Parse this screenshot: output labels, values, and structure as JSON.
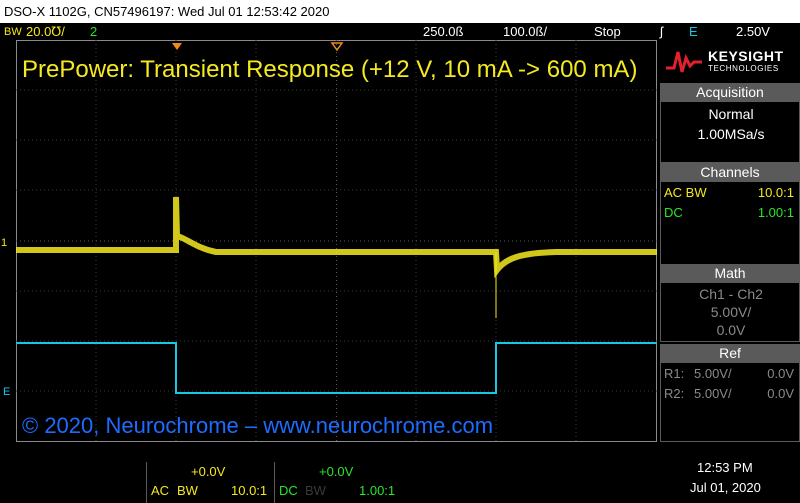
{
  "window": {
    "title": "DSO-X 1102G, CN57496197: Wed Jul 01 12:53:42 2020"
  },
  "top_status": {
    "ch1_bw": "BW",
    "ch1_scale": "20.0℧/",
    "ch2_num": "2",
    "timebase": "250.0ß",
    "delay": "100.0ß/",
    "run_state": "Stop",
    "trigger_icon": "trigger-edge-icon",
    "trigger_source": "E",
    "trigger_level": "2.50V"
  },
  "plot": {
    "title": "PrePower: Transient Response (+12 V, 10 mA -> 600 mA)",
    "copyright": "© 2020, Neurochrome – www.neurochrome.com",
    "ch1_marker": "1",
    "ext_marker": "E",
    "colors": {
      "ch1": "#f4ea1f",
      "ch2": "#19c6e6",
      "ext": "#19c6e6",
      "title": "#f4ea1f",
      "copyright": "#1e6cff"
    }
  },
  "panel": {
    "brand_name": "KEYSIGHT",
    "brand_sub": "TECHNOLOGIES",
    "acquisition": {
      "header": "Acquisition",
      "mode": "Normal",
      "rate": "1.00MSa/s"
    },
    "channels": {
      "header": "Channels",
      "rows": [
        {
          "label": "AC BW",
          "value": "10.0:1",
          "color": "#f4ea1f"
        },
        {
          "label": "DC",
          "value": "1.00:1",
          "color": "#29e629"
        }
      ]
    },
    "math": {
      "header": "Math",
      "expr": "Ch1 - Ch2",
      "scale": "5.00V/",
      "offset": "0.0V"
    },
    "ref": {
      "header": "Ref",
      "rows": [
        {
          "label": "R1:",
          "scale": "5.00V/",
          "offset": "0.0V"
        },
        {
          "label": "R2:",
          "scale": "5.00V/",
          "offset": "0.0V"
        }
      ]
    }
  },
  "bottom": {
    "ch1_offset": "+0.0V",
    "ch1_coupling": "AC",
    "ch1_bw": "BW",
    "ch1_probe": "10.0:1",
    "ch2_offset": "+0.0V",
    "ch2_coupling": "DC",
    "ch2_bw": "BW",
    "ch2_probe": "1.00:1",
    "time": "12:53 PM",
    "date": "Jul 01, 2020"
  }
}
